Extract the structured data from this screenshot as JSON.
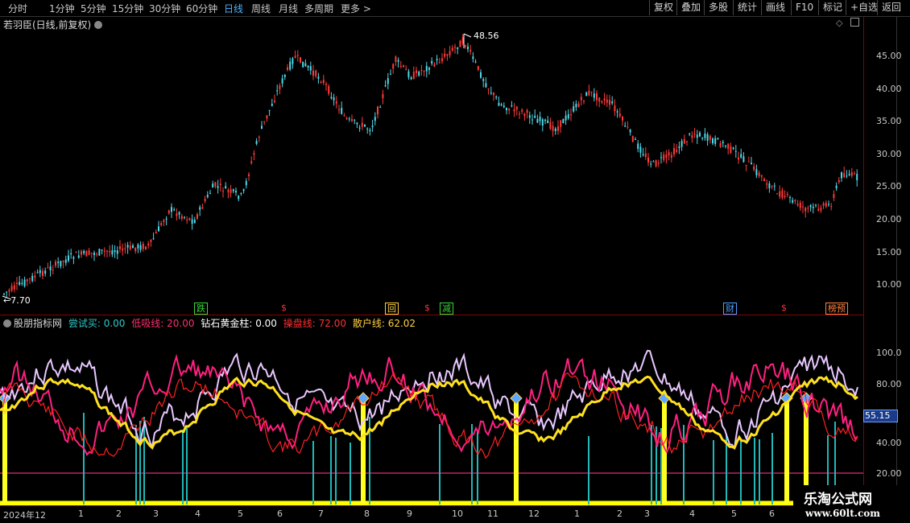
{
  "toolbar": {
    "periods": [
      "分时",
      "1分钟",
      "5分钟",
      "15分钟",
      "30分钟",
      "60分钟",
      "日线",
      "周线",
      "月线",
      "多周期",
      "更多"
    ],
    "active_period": "日线",
    "right_buttons": [
      "复权",
      "叠加",
      "多股",
      "统计",
      "画线",
      "F10",
      "标记",
      "+自选",
      "返回"
    ]
  },
  "price_panel": {
    "title": "若羽臣(日线,前复权)",
    "high_label": "48.56",
    "low_label": "7.70",
    "axis_ticks": [
      "45.00",
      "40.00",
      "35.00",
      "30.00",
      "25.00",
      "20.00",
      "15.00",
      "10.00"
    ],
    "signals": [
      {
        "text": "跌",
        "color": "#38d838"
      },
      {
        "text": "$",
        "color": "#ff3030"
      },
      {
        "text": "回",
        "color": "#ffd040"
      },
      {
        "text": "$",
        "color": "#ff3030"
      },
      {
        "text": "减",
        "color": "#38d838"
      },
      {
        "text": "财",
        "color": "#4fa0ff"
      },
      {
        "text": "$",
        "color": "#ff3030"
      },
      {
        "text": "榜预",
        "color": "#ff8040"
      }
    ]
  },
  "indicator_panel": {
    "name": "股朋指标网",
    "items": [
      {
        "label": "尝试买:",
        "value": "0.00",
        "color": "#30c8c8"
      },
      {
        "label": "低吸线:",
        "value": "20.00",
        "color": "#ff3070"
      },
      {
        "label": "钻石黄金柱:",
        "value": "0.00",
        "color": "#ffffff"
      },
      {
        "label": "操盘线:",
        "value": "72.00",
        "color": "#ff3030"
      },
      {
        "label": "散户线:",
        "value": "62.02",
        "color": "#ffd040"
      }
    ],
    "axis_ticks": [
      "100.0",
      "80.00",
      "60.00",
      "40.00",
      "20.00"
    ],
    "current_value": "55.15"
  },
  "date_axis": [
    "2024年12",
    "1",
    "2",
    "3",
    "4",
    "5",
    "6",
    "7",
    "8",
    "9",
    "10",
    "11",
    "12",
    "1",
    "2",
    "3",
    "4",
    "5",
    "6"
  ],
  "watermark": {
    "title": "乐淘公式网",
    "url": "www.60lt.com"
  },
  "icons": [
    "circle-menu-icon",
    "diamond-icon",
    "collapse-icon",
    "chevron-right-icon"
  ]
}
